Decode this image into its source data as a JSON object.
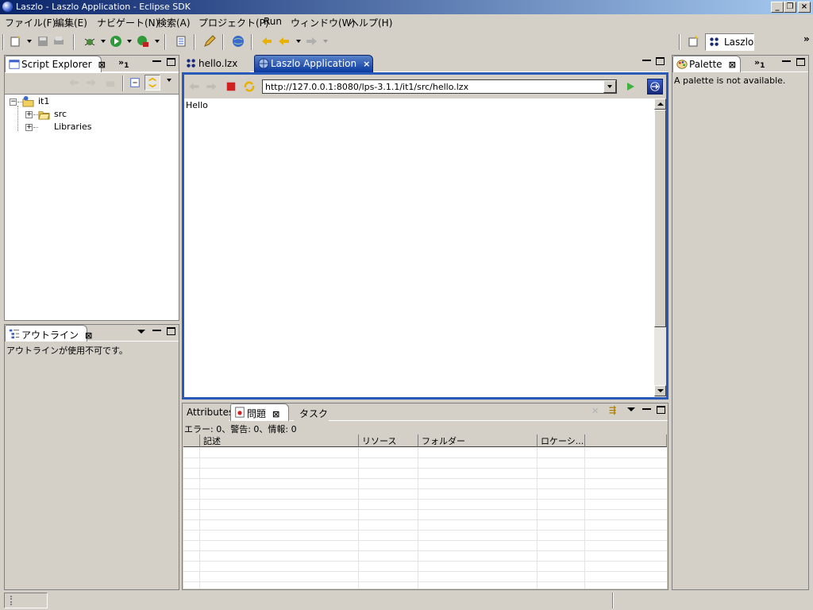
{
  "window": {
    "title": "Laszlo - Laszlo Application - Eclipse SDK"
  },
  "menu": [
    "ファイル(F)",
    "編集(E)",
    "ナビゲート(N)",
    "検索(A)",
    "プロジェクト(P)",
    "Run",
    "ウィンドウ(W)",
    "ヘルプ(H)"
  ],
  "perspective": {
    "label": "Laszlo"
  },
  "script_explorer": {
    "tab_label": "Script Explorer",
    "overflow": "1",
    "tree": [
      {
        "label": "it1",
        "icon": "project-icon"
      },
      {
        "label": "src",
        "icon": "folder-icon"
      },
      {
        "label": "Libraries",
        "icon": "library-icon"
      }
    ]
  },
  "outline": {
    "tab_label": "アウトライン",
    "message": "アウトラインが使用不可です。"
  },
  "editor": {
    "tabs": [
      {
        "label": "hello.lzx",
        "active": false
      },
      {
        "label": "Laszlo Application",
        "active": true
      }
    ],
    "url": "http://127.0.0.1:8080/lps-3.1.1/it1/src/hello.lzx",
    "content": "Hello"
  },
  "palette": {
    "tab_label": "Palette",
    "overflow": "1",
    "message": "A palette is not available."
  },
  "problems": {
    "tabs": [
      "Attributes",
      "問題",
      "タスク"
    ],
    "summary": "エラー: 0、警告: 0、情報: 0",
    "columns": [
      "記述",
      "リソース",
      "フォルダー",
      "ロケーシ..."
    ]
  },
  "colors": {
    "titlebar": "#0a246a",
    "active_tab": "#0a3aa0",
    "chrome": "#d4d0c8"
  }
}
